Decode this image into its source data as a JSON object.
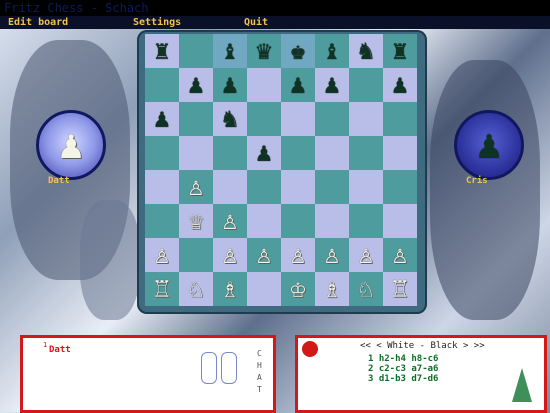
{
  "window": {
    "title": "Fritz Chess - Schach"
  },
  "menu": {
    "edit_board": "Edit board",
    "settings": "Settings",
    "quit": "Quit"
  },
  "players": {
    "left": {
      "name": "Datt",
      "piece": "♟"
    },
    "right": {
      "name": "Cris",
      "piece": "♟"
    }
  },
  "board": {
    "highlight_squares": [
      "c8",
      "e8"
    ],
    "ranks": [
      [
        "♜",
        "",
        "♝",
        "♛",
        "♚",
        "♝",
        "♞",
        "♜"
      ],
      [
        "",
        "♟",
        "♟",
        "",
        "♟",
        "♟",
        "",
        "♟"
      ],
      [
        "♟",
        "",
        "♞",
        "",
        "",
        "",
        "",
        ""
      ],
      [
        "",
        "",
        "",
        "♟",
        "",
        "",
        "",
        ""
      ],
      [
        "",
        "♙",
        "",
        "",
        "",
        "",
        "",
        ""
      ],
      [
        "",
        "♕",
        "♙",
        "",
        "",
        "",
        "",
        ""
      ],
      [
        "♙",
        "",
        "♙",
        "♙",
        "♙",
        "♙",
        "♙",
        "♙"
      ],
      [
        "♖",
        "♘",
        "♗",
        "",
        "♔",
        "♗",
        "♘",
        "♖"
      ]
    ],
    "colors": [
      [
        "b",
        "",
        "b",
        "b",
        "b",
        "b",
        "b",
        "b"
      ],
      [
        "",
        "b",
        "b",
        "",
        "b",
        "b",
        "",
        "b"
      ],
      [
        "b",
        "",
        "b",
        "",
        "",
        "",
        "",
        ""
      ],
      [
        "",
        "",
        "",
        "b",
        "",
        "",
        "",
        ""
      ],
      [
        "",
        "w",
        "",
        "",
        "",
        "",
        "",
        ""
      ],
      [
        "",
        "w",
        "w",
        "",
        "",
        "",
        "",
        ""
      ],
      [
        "w",
        "",
        "w",
        "w",
        "w",
        "w",
        "w",
        "w"
      ],
      [
        "w",
        "w",
        "w",
        "",
        "w",
        "w",
        "w",
        "w"
      ]
    ]
  },
  "left_panel": {
    "label": "Datt",
    "number": "1",
    "side_letters": [
      "C",
      "H",
      "A",
      "T"
    ]
  },
  "right_panel": {
    "header": "<< < White - Black > >>",
    "moves": [
      {
        "n": "1",
        "white": "h2-h4",
        "black": "h8-c6"
      },
      {
        "n": "2",
        "white": "c2-c3",
        "black": "a7-a6"
      },
      {
        "n": "3",
        "white": "d1-b3",
        "black": "d7-d6"
      }
    ]
  },
  "colors": {
    "accent": "#f2c24a",
    "panel_border": "#d21818",
    "move_text": "#0d6d28"
  }
}
